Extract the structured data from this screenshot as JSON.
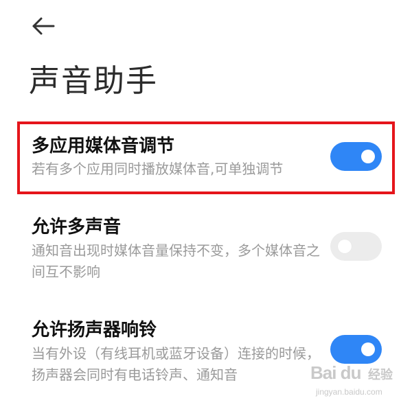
{
  "header": {
    "back_label": "",
    "title": "声音助手"
  },
  "settings": [
    {
      "title": "多应用媒体音调节",
      "description": "若有多个应用同时播放媒体音,可单独调节",
      "enabled": true
    },
    {
      "title": "允许多声音",
      "description": "通知音出现时媒体音量保持不变，多个媒体音之间互不影响",
      "enabled": false
    },
    {
      "title": "允许扬声器响铃",
      "description": "当有外设（有线耳机或蓝牙设备）连接的时候，扬声器会同时有电话铃声、通知音",
      "enabled": true
    }
  ],
  "icons": {
    "back": "arrow-left-icon"
  },
  "colors": {
    "accent": "#2f86f6",
    "toggle_off": "#ececec",
    "highlight": "#e5151b"
  },
  "watermark": {
    "logo": "Bai du",
    "cn": "经验",
    "url": "jingyan.baidu.com"
  }
}
